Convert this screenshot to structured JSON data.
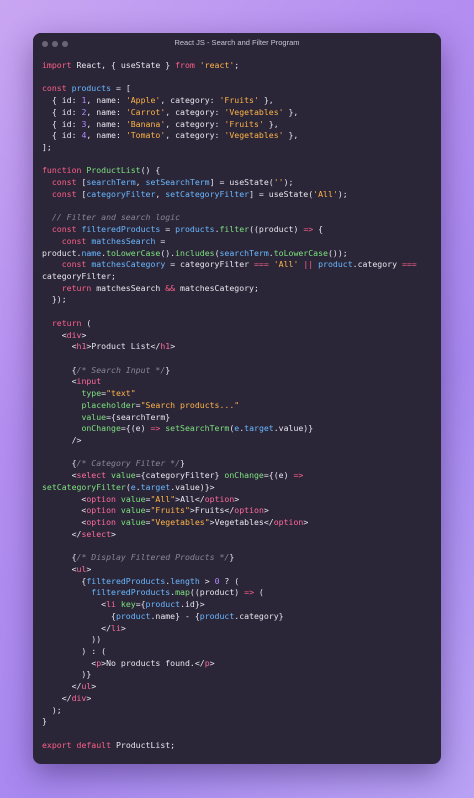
{
  "window": {
    "title": "React JS - Search and Filter Program"
  },
  "code_lines": [
    [
      [
        "kw",
        "import"
      ],
      [
        "op",
        " React, { useState } "
      ],
      [
        "kw",
        "from"
      ],
      [
        "op",
        " "
      ],
      [
        "str",
        "'react'"
      ],
      [
        "op",
        ";"
      ]
    ],
    [],
    [
      [
        "kw",
        "const"
      ],
      [
        "op",
        " "
      ],
      [
        "var",
        "products"
      ],
      [
        "op",
        " = ["
      ]
    ],
    [
      [
        "op",
        "  { id: "
      ],
      [
        "num",
        "1"
      ],
      [
        "op",
        ", name: "
      ],
      [
        "str",
        "'Apple'"
      ],
      [
        "op",
        ", category: "
      ],
      [
        "str",
        "'Fruits'"
      ],
      [
        "op",
        " },"
      ]
    ],
    [
      [
        "op",
        "  { id: "
      ],
      [
        "num",
        "2"
      ],
      [
        "op",
        ", name: "
      ],
      [
        "str",
        "'Carrot'"
      ],
      [
        "op",
        ", category: "
      ],
      [
        "str",
        "'Vegetables'"
      ],
      [
        "op",
        " },"
      ]
    ],
    [
      [
        "op",
        "  { id: "
      ],
      [
        "num",
        "3"
      ],
      [
        "op",
        ", name: "
      ],
      [
        "str",
        "'Banana'"
      ],
      [
        "op",
        ", category: "
      ],
      [
        "str",
        "'Fruits'"
      ],
      [
        "op",
        " },"
      ]
    ],
    [
      [
        "op",
        "  { id: "
      ],
      [
        "num",
        "4"
      ],
      [
        "op",
        ", name: "
      ],
      [
        "str",
        "'Tomato'"
      ],
      [
        "op",
        ", category: "
      ],
      [
        "str",
        "'Vegetables'"
      ],
      [
        "op",
        " },"
      ]
    ],
    [
      [
        "op",
        "];"
      ]
    ],
    [],
    [
      [
        "kw",
        "function"
      ],
      [
        "op",
        " "
      ],
      [
        "fn",
        "ProductList"
      ],
      [
        "op",
        "() {"
      ]
    ],
    [
      [
        "op",
        "  "
      ],
      [
        "kw",
        "const"
      ],
      [
        "op",
        " ["
      ],
      [
        "var",
        "searchTerm"
      ],
      [
        "op",
        ", "
      ],
      [
        "var",
        "setSearchTerm"
      ],
      [
        "op",
        "] = useState("
      ],
      [
        "str",
        "''"
      ],
      [
        "op",
        ");"
      ]
    ],
    [
      [
        "op",
        "  "
      ],
      [
        "kw",
        "const"
      ],
      [
        "op",
        " ["
      ],
      [
        "var",
        "categoryFilter"
      ],
      [
        "op",
        ", "
      ],
      [
        "var",
        "setCategoryFilter"
      ],
      [
        "op",
        "] = useState("
      ],
      [
        "str",
        "'All'"
      ],
      [
        "op",
        ");"
      ]
    ],
    [],
    [
      [
        "cm",
        "  // Filter and search logic"
      ]
    ],
    [
      [
        "op",
        "  "
      ],
      [
        "kw",
        "const"
      ],
      [
        "op",
        " "
      ],
      [
        "var",
        "filteredProducts"
      ],
      [
        "op",
        " = "
      ],
      [
        "var",
        "products"
      ],
      [
        "op",
        "."
      ],
      [
        "fn",
        "filter"
      ],
      [
        "op",
        "((product) "
      ],
      [
        "kw",
        "=>"
      ],
      [
        "op",
        " {"
      ]
    ],
    [
      [
        "op",
        "    "
      ],
      [
        "kw",
        "const"
      ],
      [
        "op",
        " "
      ],
      [
        "var",
        "matchesSearch"
      ],
      [
        "op",
        " ="
      ]
    ],
    [
      [
        "op",
        "product."
      ],
      [
        "var",
        "name"
      ],
      [
        "op",
        "."
      ],
      [
        "fn",
        "toLowerCase"
      ],
      [
        "op",
        "()."
      ],
      [
        "fn",
        "includes"
      ],
      [
        "op",
        "("
      ],
      [
        "var",
        "searchTerm"
      ],
      [
        "op",
        "."
      ],
      [
        "fn",
        "toLowerCase"
      ],
      [
        "op",
        "());"
      ]
    ],
    [
      [
        "op",
        "    "
      ],
      [
        "kw",
        "const"
      ],
      [
        "op",
        " "
      ],
      [
        "var",
        "matchesCategory"
      ],
      [
        "op",
        " = categoryFilter "
      ],
      [
        "kw",
        "==="
      ],
      [
        "op",
        " "
      ],
      [
        "str",
        "'All'"
      ],
      [
        "op",
        " "
      ],
      [
        "kw",
        "||"
      ],
      [
        "op",
        " "
      ],
      [
        "var",
        "product"
      ],
      [
        "op",
        ".category "
      ],
      [
        "kw",
        "==="
      ]
    ],
    [
      [
        "op",
        "categoryFilter;"
      ]
    ],
    [
      [
        "op",
        "    "
      ],
      [
        "kw",
        "return"
      ],
      [
        "op",
        " matchesSearch "
      ],
      [
        "kw",
        "&&"
      ],
      [
        "op",
        " matchesCategory;"
      ]
    ],
    [
      [
        "op",
        "  });"
      ]
    ],
    [],
    [
      [
        "op",
        "  "
      ],
      [
        "kw",
        "return"
      ],
      [
        "op",
        " ("
      ]
    ],
    [
      [
        "op",
        "    <"
      ],
      [
        "tag",
        "div"
      ],
      [
        "op",
        ">"
      ]
    ],
    [
      [
        "op",
        "      <"
      ],
      [
        "tag",
        "h1"
      ],
      [
        "op",
        ">Product List</"
      ],
      [
        "tag",
        "h1"
      ],
      [
        "op",
        ">"
      ]
    ],
    [],
    [
      [
        "op",
        "      {"
      ],
      [
        "cm",
        "/* Search Input */"
      ],
      [
        "op",
        "}"
      ]
    ],
    [
      [
        "op",
        "      <"
      ],
      [
        "tag",
        "input"
      ]
    ],
    [
      [
        "op",
        "        "
      ],
      [
        "fn",
        "type"
      ],
      [
        "op",
        "="
      ],
      [
        "str",
        "\"text\""
      ]
    ],
    [
      [
        "op",
        "        "
      ],
      [
        "fn",
        "placeholder"
      ],
      [
        "op",
        "="
      ],
      [
        "str",
        "\"Search products...\""
      ]
    ],
    [
      [
        "op",
        "        "
      ],
      [
        "fn",
        "value"
      ],
      [
        "op",
        "={searchTerm}"
      ]
    ],
    [
      [
        "op",
        "        "
      ],
      [
        "fn",
        "onChange"
      ],
      [
        "op",
        "={(e) "
      ],
      [
        "kw",
        "=>"
      ],
      [
        "op",
        " "
      ],
      [
        "fn",
        "setSearchTerm"
      ],
      [
        "op",
        "("
      ],
      [
        "var",
        "e"
      ],
      [
        "op",
        "."
      ],
      [
        "var",
        "target"
      ],
      [
        "op",
        ".value)}"
      ]
    ],
    [
      [
        "op",
        "      />"
      ]
    ],
    [],
    [
      [
        "op",
        "      {"
      ],
      [
        "cm",
        "/* Category Filter */"
      ],
      [
        "op",
        "}"
      ]
    ],
    [
      [
        "op",
        "      <"
      ],
      [
        "tag",
        "select"
      ],
      [
        "op",
        " "
      ],
      [
        "fn",
        "value"
      ],
      [
        "op",
        "={categoryFilter} "
      ],
      [
        "fn",
        "onChange"
      ],
      [
        "op",
        "={(e) "
      ],
      [
        "kw",
        "=>"
      ]
    ],
    [
      [
        "fn",
        "setCategoryFilter"
      ],
      [
        "op",
        "("
      ],
      [
        "var",
        "e"
      ],
      [
        "op",
        "."
      ],
      [
        "var",
        "target"
      ],
      [
        "op",
        ".value)}>"
      ]
    ],
    [
      [
        "op",
        "        <"
      ],
      [
        "tag",
        "option"
      ],
      [
        "op",
        " "
      ],
      [
        "fn",
        "value"
      ],
      [
        "op",
        "="
      ],
      [
        "str",
        "\"All\""
      ],
      [
        "op",
        ">All</"
      ],
      [
        "tag",
        "option"
      ],
      [
        "op",
        ">"
      ]
    ],
    [
      [
        "op",
        "        <"
      ],
      [
        "tag",
        "option"
      ],
      [
        "op",
        " "
      ],
      [
        "fn",
        "value"
      ],
      [
        "op",
        "="
      ],
      [
        "str",
        "\"Fruits\""
      ],
      [
        "op",
        ">Fruits</"
      ],
      [
        "tag",
        "option"
      ],
      [
        "op",
        ">"
      ]
    ],
    [
      [
        "op",
        "        <"
      ],
      [
        "tag",
        "option"
      ],
      [
        "op",
        " "
      ],
      [
        "fn",
        "value"
      ],
      [
        "op",
        "="
      ],
      [
        "str",
        "\"Vegetables\""
      ],
      [
        "op",
        ">Vegetables</"
      ],
      [
        "tag",
        "option"
      ],
      [
        "op",
        ">"
      ]
    ],
    [
      [
        "op",
        "      </"
      ],
      [
        "tag",
        "select"
      ],
      [
        "op",
        ">"
      ]
    ],
    [],
    [
      [
        "op",
        "      {"
      ],
      [
        "cm",
        "/* Display Filtered Products */"
      ],
      [
        "op",
        "}"
      ]
    ],
    [
      [
        "op",
        "      <"
      ],
      [
        "tag",
        "ul"
      ],
      [
        "op",
        ">"
      ]
    ],
    [
      [
        "op",
        "        {"
      ],
      [
        "var",
        "filteredProducts"
      ],
      [
        "op",
        "."
      ],
      [
        "var",
        "length"
      ],
      [
        "op",
        " > "
      ],
      [
        "num",
        "0"
      ],
      [
        "op",
        " ? ("
      ]
    ],
    [
      [
        "op",
        "          "
      ],
      [
        "var",
        "filteredProducts"
      ],
      [
        "op",
        "."
      ],
      [
        "fn",
        "map"
      ],
      [
        "op",
        "((product) "
      ],
      [
        "kw",
        "=>"
      ],
      [
        "op",
        " ("
      ]
    ],
    [
      [
        "op",
        "            <"
      ],
      [
        "tag",
        "li"
      ],
      [
        "op",
        " "
      ],
      [
        "fn",
        "key"
      ],
      [
        "op",
        "={"
      ],
      [
        "var",
        "product"
      ],
      [
        "op",
        ".id}>"
      ]
    ],
    [
      [
        "op",
        "              {"
      ],
      [
        "var",
        "product"
      ],
      [
        "op",
        ".name} - {"
      ],
      [
        "var",
        "product"
      ],
      [
        "op",
        ".category}"
      ]
    ],
    [
      [
        "op",
        "            </"
      ],
      [
        "tag",
        "li"
      ],
      [
        "op",
        ">"
      ]
    ],
    [
      [
        "op",
        "          ))"
      ]
    ],
    [
      [
        "op",
        "        ) : ("
      ]
    ],
    [
      [
        "op",
        "          <"
      ],
      [
        "tag",
        "p"
      ],
      [
        "op",
        ">No products found.</"
      ],
      [
        "tag",
        "p"
      ],
      [
        "op",
        ">"
      ]
    ],
    [
      [
        "op",
        "        )}"
      ]
    ],
    [
      [
        "op",
        "      </"
      ],
      [
        "tag",
        "ul"
      ],
      [
        "op",
        ">"
      ]
    ],
    [
      [
        "op",
        "    </"
      ],
      [
        "tag",
        "div"
      ],
      [
        "op",
        ">"
      ]
    ],
    [
      [
        "op",
        "  );"
      ]
    ],
    [
      [
        "op",
        "}"
      ]
    ],
    [],
    [
      [
        "kw",
        "export"
      ],
      [
        "op",
        " "
      ],
      [
        "kw",
        "default"
      ],
      [
        "op",
        " ProductList;"
      ]
    ]
  ],
  "colors": {
    "keyword": "#ff5f87",
    "string": "#ffb347",
    "number": "#b388ff",
    "function": "#7ee07e",
    "variable": "#6ab8ff",
    "comment": "#8a8699",
    "background": "#2a2638"
  }
}
